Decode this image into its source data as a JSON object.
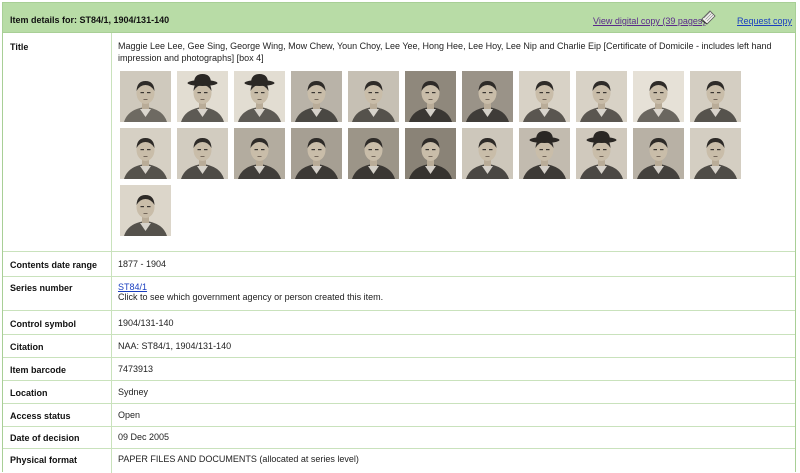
{
  "header": {
    "title": "Item details for: ST84/1, 1904/131-140",
    "view_digital_copy": "View digital copy (39 pages)",
    "request_copy": "Request copy"
  },
  "rows": {
    "title": {
      "label": "Title",
      "value": "Maggie Lee Lee, Gee Sing, George Wing, Mow Chew, Youn Choy, Lee Yee, Hong Hee, Lee Hoy, Lee Nip and Charlie Eip [Certificate of Domicile - includes left hand impression and photographs] [box 4]"
    },
    "contents_date_range": {
      "label": "Contents date range",
      "value": "1877 - 1904"
    },
    "series_number": {
      "label": "Series number",
      "value": "ST84/1",
      "note": "Click to see which government agency or person created this item."
    },
    "control_symbol": {
      "label": "Control symbol",
      "value": "1904/131-140"
    },
    "citation": {
      "label": "Citation",
      "value": "NAA: ST84/1, 1904/131-140"
    },
    "item_barcode": {
      "label": "Item barcode",
      "value": "7473913"
    },
    "location": {
      "label": "Location",
      "value": "Sydney"
    },
    "access_status": {
      "label": "Access status",
      "value": "Open"
    },
    "date_of_decision": {
      "label": "Date of decision",
      "value": "09 Dec 2005"
    },
    "physical_format": {
      "label": "Physical format",
      "value": "PAPER FILES AND DOCUMENTS (allocated at series level)"
    }
  },
  "thumbnails": [
    {
      "tone": "#6e6a62",
      "bg": "#cfc9bd",
      "hat": false
    },
    {
      "tone": "#5d5a54",
      "bg": "#e2ddd2",
      "hat": true
    },
    {
      "tone": "#5d5a54",
      "bg": "#e2ddd2",
      "hat": true
    },
    {
      "tone": "#4a4843",
      "bg": "#b9b3a8",
      "hat": false
    },
    {
      "tone": "#55524c",
      "bg": "#c6c0b4",
      "hat": false
    },
    {
      "tone": "#3a3733",
      "bg": "#8f887c",
      "hat": false
    },
    {
      "tone": "#3f3c38",
      "bg": "#9a9388",
      "hat": false
    },
    {
      "tone": "#5a5650",
      "bg": "#d8d2c6",
      "hat": false
    },
    {
      "tone": "#5a5650",
      "bg": "#d8d2c6",
      "hat": false
    },
    {
      "tone": "#6a665f",
      "bg": "#e6e1d7",
      "hat": false
    },
    {
      "tone": "#56534d",
      "bg": "#d4cec2",
      "hat": false
    },
    {
      "tone": "#55524c",
      "bg": "#d6d0c4",
      "hat": false
    },
    {
      "tone": "#4e4b46",
      "bg": "#d2ccc0",
      "hat": false
    },
    {
      "tone": "#403d39",
      "bg": "#b3ac9f",
      "hat": false
    },
    {
      "tone": "#3c3935",
      "bg": "#a69f93",
      "hat": false
    },
    {
      "tone": "#3a3733",
      "bg": "#9c9588",
      "hat": false
    },
    {
      "tone": "#36332f",
      "bg": "#8a8377",
      "hat": false
    },
    {
      "tone": "#4a4743",
      "bg": "#cdc7bb",
      "hat": false
    },
    {
      "tone": "#3d3a36",
      "bg": "#c2bbaf",
      "hat": true
    },
    {
      "tone": "#4b4844",
      "bg": "#d0c9bd",
      "hat": true
    },
    {
      "tone": "#44413d",
      "bg": "#b8b1a5",
      "hat": false
    },
    {
      "tone": "#4f4c47",
      "bg": "#d4cec2",
      "hat": false
    },
    {
      "tone": "#55524c",
      "bg": "#dcd6ca",
      "hat": false
    }
  ]
}
